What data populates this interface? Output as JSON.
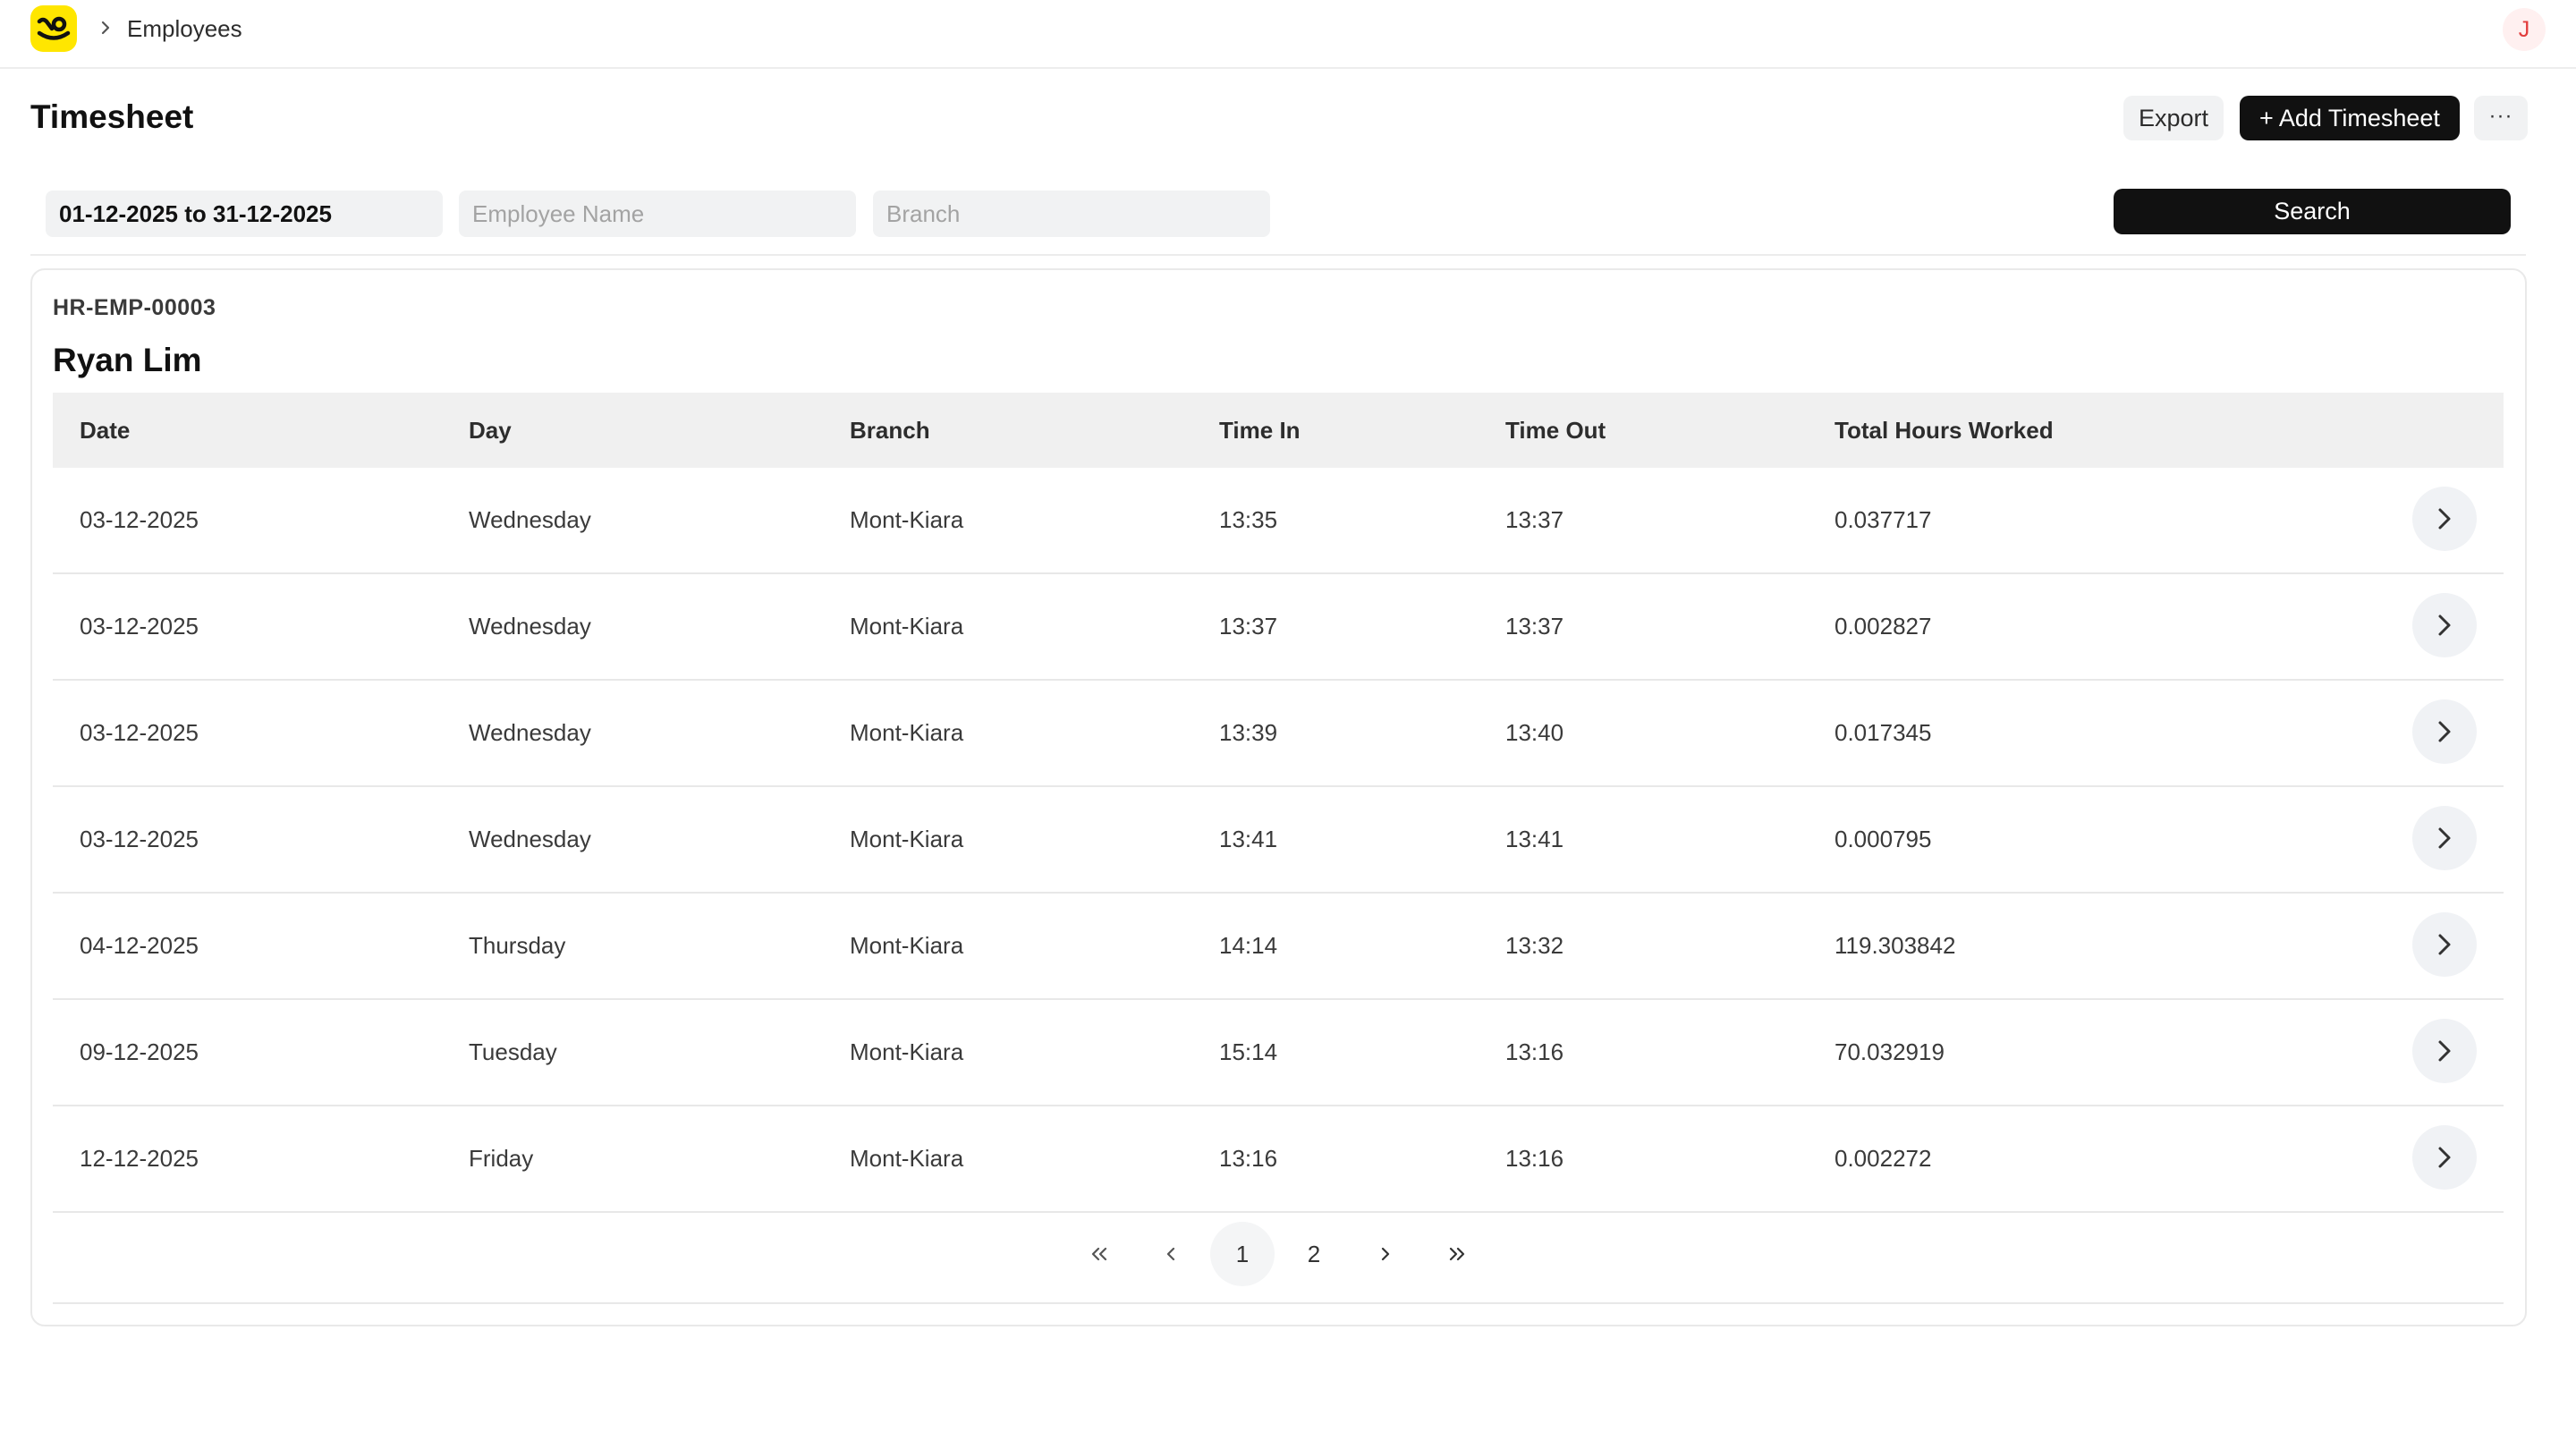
{
  "nav": {
    "breadcrumb_label": "Employees",
    "user_initial": "J"
  },
  "header": {
    "title": "Timesheet",
    "export_label": "Export",
    "add_label": "+ Add Timesheet",
    "more_label": "···"
  },
  "filters": {
    "date_range": "01-12-2025 to 31-12-2025",
    "employee_placeholder": "Employee Name",
    "branch_placeholder": "Branch",
    "search_label": "Search"
  },
  "employee": {
    "id": "HR-EMP-00003",
    "name": "Ryan Lim"
  },
  "table": {
    "headers": {
      "date": "Date",
      "day": "Day",
      "branch": "Branch",
      "time_in": "Time In",
      "time_out": "Time Out",
      "total": "Total Hours Worked"
    },
    "rows": [
      {
        "date": "03-12-2025",
        "day": "Wednesday",
        "branch": "Mont-Kiara",
        "time_in": "13:35",
        "time_out": "13:37",
        "total": "0.037717"
      },
      {
        "date": "03-12-2025",
        "day": "Wednesday",
        "branch": "Mont-Kiara",
        "time_in": "13:37",
        "time_out": "13:37",
        "total": "0.002827"
      },
      {
        "date": "03-12-2025",
        "day": "Wednesday",
        "branch": "Mont-Kiara",
        "time_in": "13:39",
        "time_out": "13:40",
        "total": "0.017345"
      },
      {
        "date": "03-12-2025",
        "day": "Wednesday",
        "branch": "Mont-Kiara",
        "time_in": "13:41",
        "time_out": "13:41",
        "total": "0.000795"
      },
      {
        "date": "04-12-2025",
        "day": "Thursday",
        "branch": "Mont-Kiara",
        "time_in": "14:14",
        "time_out": "13:32",
        "total": "119.303842"
      },
      {
        "date": "09-12-2025",
        "day": "Tuesday",
        "branch": "Mont-Kiara",
        "time_in": "15:14",
        "time_out": "13:16",
        "total": "70.032919"
      },
      {
        "date": "12-12-2025",
        "day": "Friday",
        "branch": "Mont-Kiara",
        "time_in": "13:16",
        "time_out": "13:16",
        "total": "0.002272"
      }
    ]
  },
  "pagination": {
    "pages": [
      "1",
      "2"
    ],
    "current": "1"
  },
  "colors": {
    "brand": "#ffe600",
    "primary_button": "#111111",
    "avatar_text": "#e23b3b"
  }
}
